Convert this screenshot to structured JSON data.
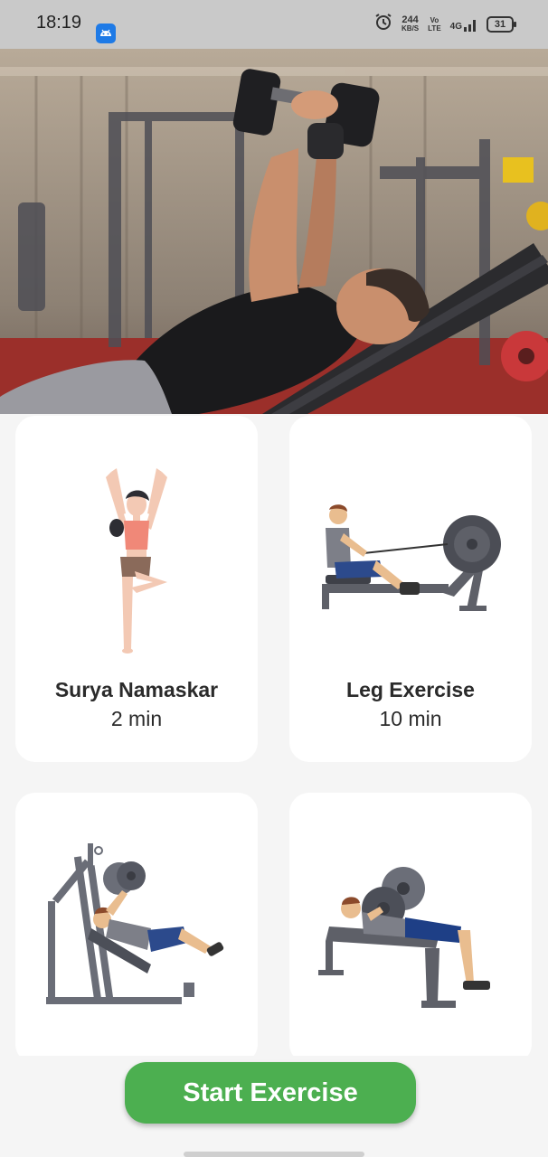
{
  "status_bar": {
    "time": "18:19",
    "speed_value": "244",
    "speed_unit": "KB/S",
    "volte_top": "Vo",
    "volte_bottom": "LTE",
    "network": "4G",
    "battery": "31",
    "icons": [
      "android-app-icon",
      "alarm-icon",
      "signal-icon",
      "battery-icon"
    ]
  },
  "hero": {
    "image": "man lifting dumbbells on incline bench in gym"
  },
  "exercises": [
    {
      "title": "Surya Namaskar",
      "duration": "2 min",
      "illustration": "yoga-tree-pose"
    },
    {
      "title": "Leg Exercise",
      "duration": "10 min",
      "illustration": "rowing-machine"
    },
    {
      "title": "",
      "duration": "",
      "illustration": "leg-press-machine"
    },
    {
      "title": "",
      "duration": "",
      "illustration": "bench-press"
    }
  ],
  "actions": {
    "start_label": "Start Exercise"
  },
  "colors": {
    "accent": "#4caf50",
    "card_bg": "#ffffff",
    "page_bg": "#f5f5f5",
    "status_bar_bg": "#c9c9c9"
  }
}
